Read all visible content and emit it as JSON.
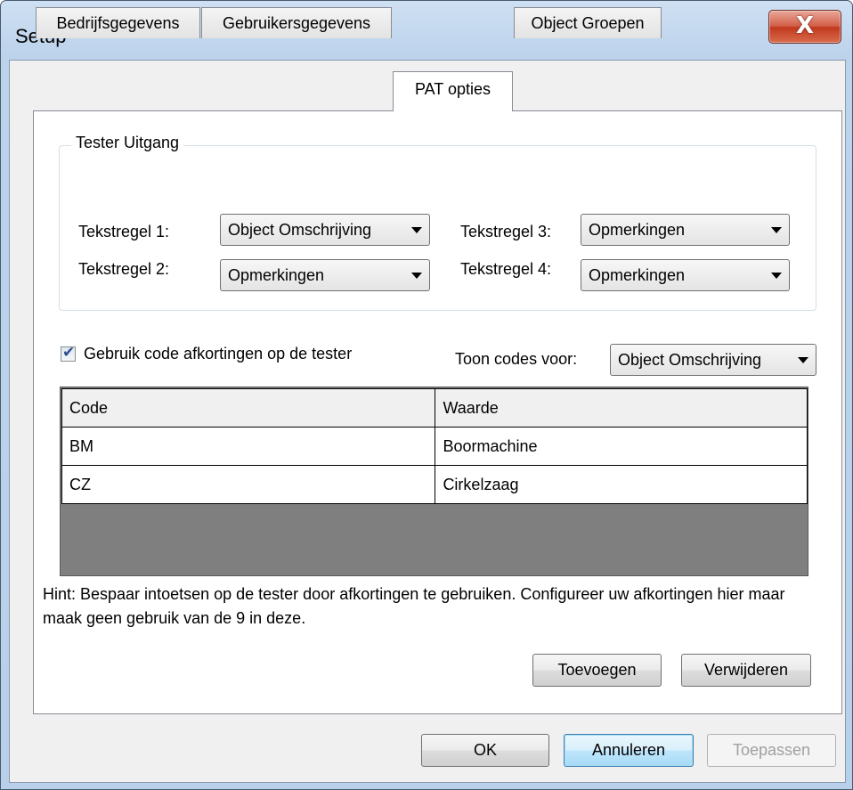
{
  "window": {
    "title": "Setup",
    "close_glyph": "X"
  },
  "tabs": [
    {
      "label": "Bedrijfsgegevens",
      "active": false
    },
    {
      "label": "Gebruikersgegevens",
      "active": false
    },
    {
      "label": "PAT opties",
      "active": true
    },
    {
      "label": "Object Groepen",
      "active": false
    }
  ],
  "tester_group": {
    "title": "Tester Uitgang",
    "lines": [
      {
        "label": "Tekstregel 1:",
        "value": "Object Omschrijving"
      },
      {
        "label": "Tekstregel 2:",
        "value": "Opmerkingen"
      },
      {
        "label": "Tekstregel 3:",
        "value": "Opmerkingen"
      },
      {
        "label": "Tekstregel 4:",
        "value": "Opmerkingen"
      }
    ]
  },
  "abbreviations": {
    "checkbox_label": "Gebruik code afkortingen op de tester",
    "checked": true,
    "check_glyph": "✔",
    "show_codes_label": "Toon codes voor:",
    "show_codes_value": "Object Omschrijving"
  },
  "grid": {
    "headers": [
      "Code",
      "Waarde"
    ],
    "rows": [
      [
        "BM",
        "Boormachine"
      ],
      [
        "CZ",
        "Cirkelzaag"
      ]
    ]
  },
  "hint": "Hint: Bespaar intoetsen op de tester door afkortingen te gebruiken. Configureer uw afkortingen hier maar maak geen gebruik van de 9 in deze.",
  "buttons": {
    "add": "Toevoegen",
    "remove": "Verwijderen",
    "ok": "OK",
    "cancel": "Annuleren",
    "apply": "Toepassen"
  },
  "colors": {
    "title_bar": "#bdd3ec",
    "close_button": "#c2391f",
    "grid_background": "#7f7f7f"
  },
  "icons": {
    "close": "close-icon",
    "dropdown": "chevron-down-icon",
    "check": "checkmark-icon"
  }
}
